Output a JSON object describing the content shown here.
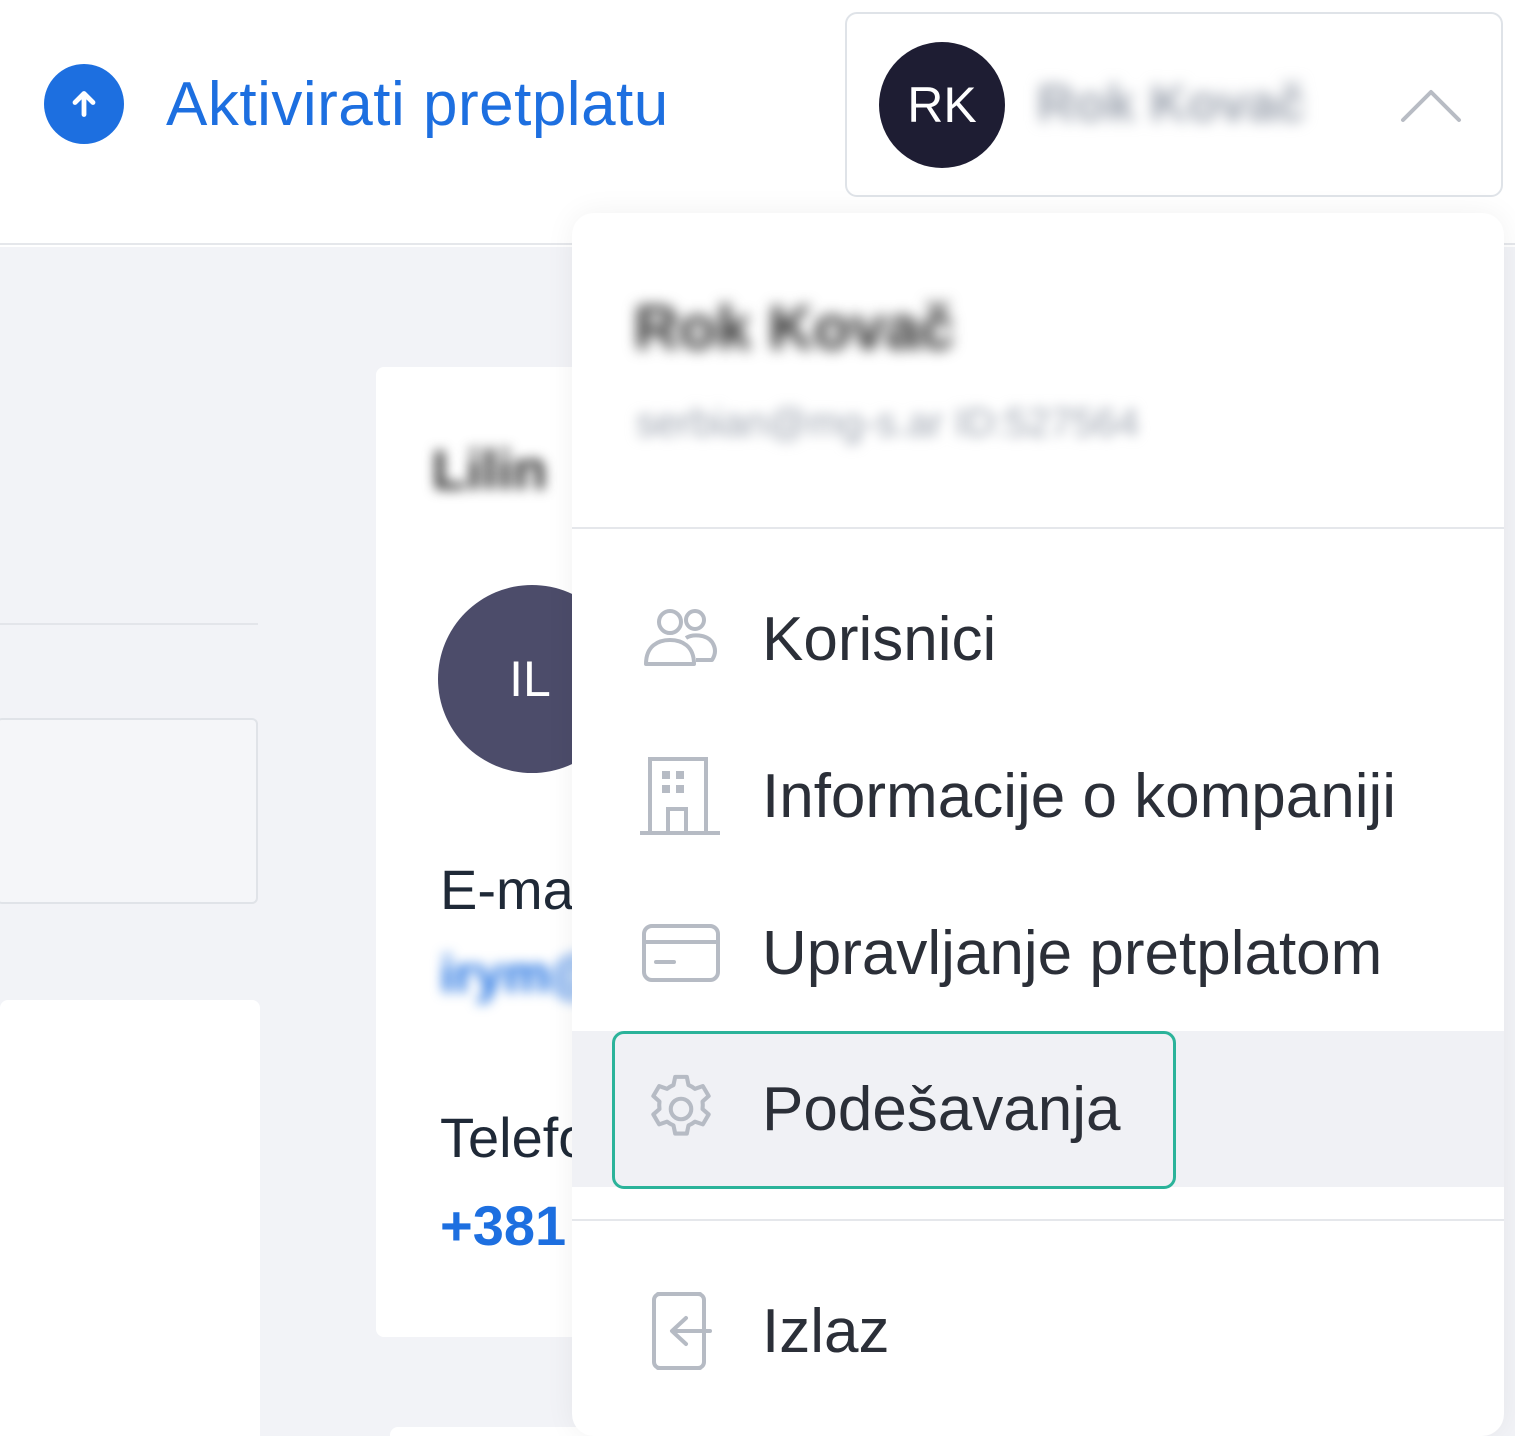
{
  "header": {
    "activate_label": "Aktivirati pretplatu",
    "user": {
      "initials": "RK",
      "name": "Rok Kovač"
    }
  },
  "dropdown": {
    "user_name": "Rok Kovač",
    "user_email": "serbian@mg-s.ar ID:527564",
    "items": [
      {
        "label": "Korisnici",
        "icon": "users-icon"
      },
      {
        "label": "Informacije o kompaniji",
        "icon": "building-icon"
      },
      {
        "label": "Upravljanje pretplatom",
        "icon": "credit-card-icon"
      },
      {
        "label": "Podešavanja",
        "icon": "gear-icon",
        "active": true
      },
      {
        "label": "Izlaz",
        "icon": "logout-icon"
      }
    ]
  },
  "contact_card": {
    "title": "Lilin",
    "avatar_initials": "IL",
    "email_label": "E-mail",
    "email_value": "irym@",
    "phone_label": "Telefon",
    "phone_value": "+381"
  },
  "colors": {
    "accent": "#1d6fe0",
    "avatar_dark": "#1e1d33",
    "avatar_il": "#4c4c6a",
    "focus_ring": "#2bb39a",
    "active_bg": "#f0f1f5"
  }
}
